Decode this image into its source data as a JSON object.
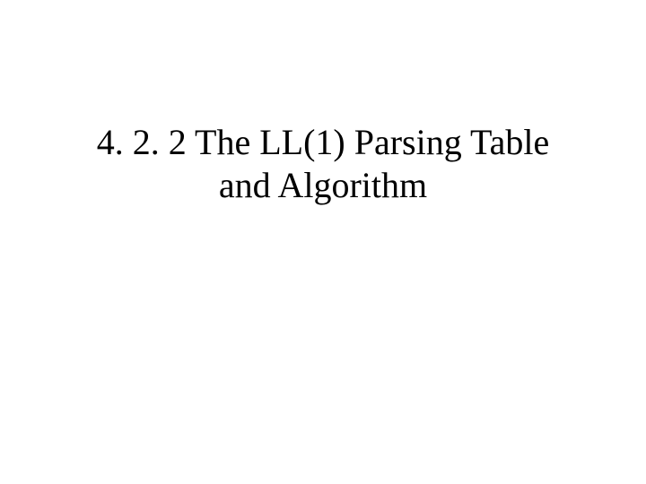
{
  "slide": {
    "title_line1": "4. 2. 2 The LL(1) Parsing Table",
    "title_line2": "and Algorithm"
  }
}
